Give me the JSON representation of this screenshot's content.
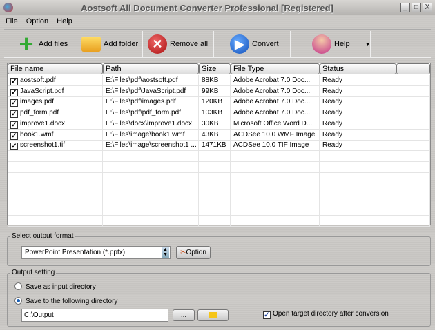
{
  "window": {
    "title": "Aostsoft All Document Converter Professional [Registered]",
    "min": "_",
    "max": "□",
    "close": "X"
  },
  "menu": [
    "File",
    "Option",
    "Help"
  ],
  "toolbar": {
    "add_files": "Add files",
    "add_folder": "Add folder",
    "remove_all": "Remove all",
    "convert": "Convert",
    "help": "Help"
  },
  "table": {
    "columns": [
      "File name",
      "Path",
      "Size",
      "File Type",
      "Status"
    ],
    "rows": [
      [
        "aostsoft.pdf",
        "E:\\Files\\pdf\\aostsoft.pdf",
        "88KB",
        "Adobe Acrobat 7.0 Doc...",
        "Ready"
      ],
      [
        "JavaScript.pdf",
        "E:\\Files\\pdf\\JavaScript.pdf",
        "99KB",
        "Adobe Acrobat 7.0 Doc...",
        "Ready"
      ],
      [
        "images.pdf",
        "E:\\Files\\pdf\\images.pdf",
        "120KB",
        "Adobe Acrobat 7.0 Doc...",
        "Ready"
      ],
      [
        "pdf_form.pdf",
        "E:\\Files\\pdf\\pdf_form.pdf",
        "103KB",
        "Adobe Acrobat 7.0 Doc...",
        "Ready"
      ],
      [
        "improve1.docx",
        "E:\\Files\\docx\\improve1.docx",
        "30KB",
        "Microsoft Office Word D...",
        "Ready"
      ],
      [
        "book1.wmf",
        "E:\\Files\\image\\book1.wmf",
        "43KB",
        "ACDSee 10.0 WMF Image",
        "Ready"
      ],
      [
        "screenshot1.tif",
        "E:\\Files\\image\\screenshot1 ...",
        "1471KB",
        "ACDSee 10.0 TIF Image",
        "Ready"
      ]
    ]
  },
  "output_format": {
    "label": "Select output format",
    "selected": "PowerPoint Presentation (*.pptx)",
    "option_button": "Option"
  },
  "output_setting": {
    "label": "Output setting",
    "radio_input": "Save as input directory",
    "radio_following": "Save to the following directory",
    "directory": "C:\\Output",
    "browse": "...",
    "open_after": "Open target directory after conversion"
  }
}
